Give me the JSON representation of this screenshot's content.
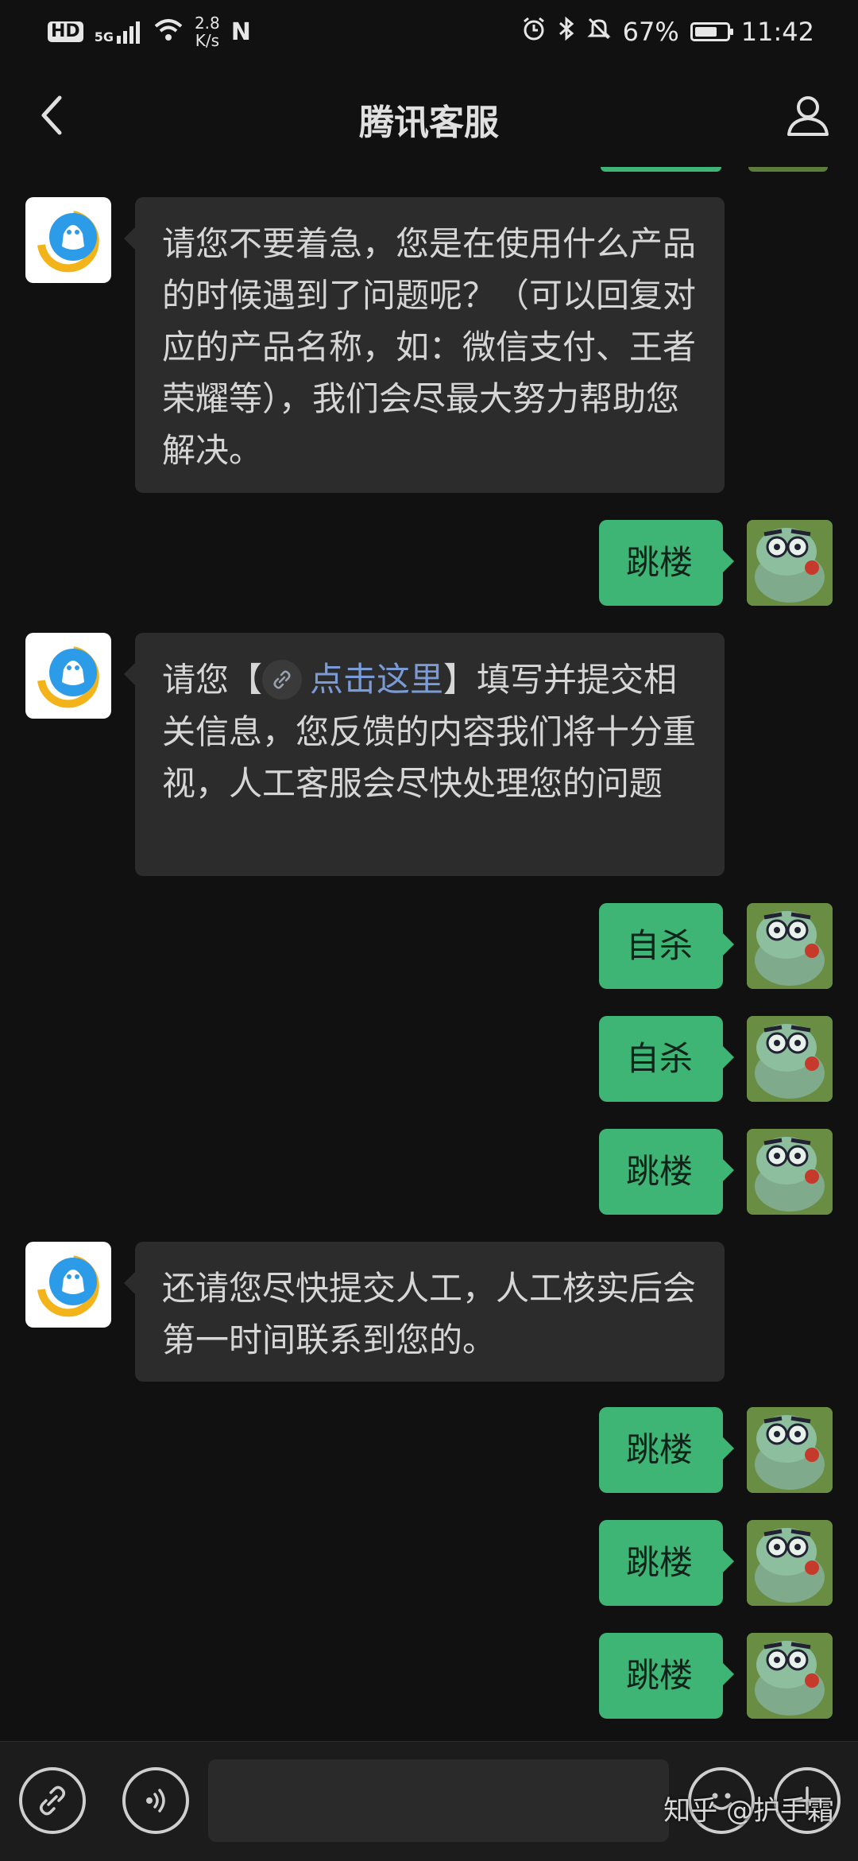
{
  "status_bar": {
    "hd": "HD",
    "network": "5G",
    "speed_value": "2.8",
    "speed_unit": "K/s",
    "nfc": "N",
    "battery": "67%",
    "time": "11:42"
  },
  "nav": {
    "title": "腾讯客服"
  },
  "messages": [
    {
      "from": "bot",
      "text": "请您不要着急，您是在使用什么产品的时候遇到了问题呢？（可以回复对应的产品名称，如：微信支付、王者荣耀等），我们会尽最大努力帮助您解决。"
    },
    {
      "from": "user",
      "text": "跳楼"
    },
    {
      "from": "bot",
      "text_before": "请您【",
      "link_text": "点击这里",
      "text_after": "】填写并提交相关信息，您反馈的内容我们将十分重视，人工客服会尽快处理您的问题"
    },
    {
      "from": "user",
      "text": "自杀"
    },
    {
      "from": "user",
      "text": "自杀"
    },
    {
      "from": "user",
      "text": "跳楼"
    },
    {
      "from": "bot",
      "text": "还请您尽快提交人工，人工核实后会第一时间联系到您的。"
    },
    {
      "from": "user",
      "text": "跳楼"
    },
    {
      "from": "user",
      "text": "跳楼"
    },
    {
      "from": "user",
      "text": "跳楼"
    }
  ],
  "input": {
    "placeholder": ""
  },
  "watermark": "知乎 @护手霜",
  "colors": {
    "background": "#111111",
    "bubble_incoming": "#2c2c2c",
    "bubble_outgoing": "#3eb575",
    "link": "#7a9bd6"
  }
}
